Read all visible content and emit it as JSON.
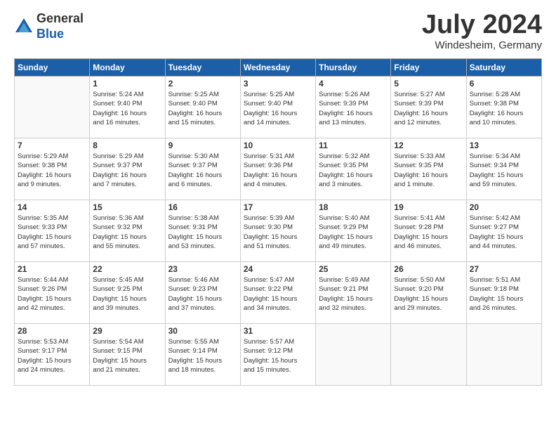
{
  "header": {
    "logo_general": "General",
    "logo_blue": "Blue",
    "month_title": "July 2024",
    "subtitle": "Windesheim, Germany"
  },
  "weekdays": [
    "Sunday",
    "Monday",
    "Tuesday",
    "Wednesday",
    "Thursday",
    "Friday",
    "Saturday"
  ],
  "weeks": [
    [
      {
        "day": "",
        "info": ""
      },
      {
        "day": "1",
        "info": "Sunrise: 5:24 AM\nSunset: 9:40 PM\nDaylight: 16 hours\nand 16 minutes."
      },
      {
        "day": "2",
        "info": "Sunrise: 5:25 AM\nSunset: 9:40 PM\nDaylight: 16 hours\nand 15 minutes."
      },
      {
        "day": "3",
        "info": "Sunrise: 5:25 AM\nSunset: 9:40 PM\nDaylight: 16 hours\nand 14 minutes."
      },
      {
        "day": "4",
        "info": "Sunrise: 5:26 AM\nSunset: 9:39 PM\nDaylight: 16 hours\nand 13 minutes."
      },
      {
        "day": "5",
        "info": "Sunrise: 5:27 AM\nSunset: 9:39 PM\nDaylight: 16 hours\nand 12 minutes."
      },
      {
        "day": "6",
        "info": "Sunrise: 5:28 AM\nSunset: 9:38 PM\nDaylight: 16 hours\nand 10 minutes."
      }
    ],
    [
      {
        "day": "7",
        "info": "Sunrise: 5:29 AM\nSunset: 9:38 PM\nDaylight: 16 hours\nand 9 minutes."
      },
      {
        "day": "8",
        "info": "Sunrise: 5:29 AM\nSunset: 9:37 PM\nDaylight: 16 hours\nand 7 minutes."
      },
      {
        "day": "9",
        "info": "Sunrise: 5:30 AM\nSunset: 9:37 PM\nDaylight: 16 hours\nand 6 minutes."
      },
      {
        "day": "10",
        "info": "Sunrise: 5:31 AM\nSunset: 9:36 PM\nDaylight: 16 hours\nand 4 minutes."
      },
      {
        "day": "11",
        "info": "Sunrise: 5:32 AM\nSunset: 9:35 PM\nDaylight: 16 hours\nand 3 minutes."
      },
      {
        "day": "12",
        "info": "Sunrise: 5:33 AM\nSunset: 9:35 PM\nDaylight: 16 hours\nand 1 minute."
      },
      {
        "day": "13",
        "info": "Sunrise: 5:34 AM\nSunset: 9:34 PM\nDaylight: 15 hours\nand 59 minutes."
      }
    ],
    [
      {
        "day": "14",
        "info": "Sunrise: 5:35 AM\nSunset: 9:33 PM\nDaylight: 15 hours\nand 57 minutes."
      },
      {
        "day": "15",
        "info": "Sunrise: 5:36 AM\nSunset: 9:32 PM\nDaylight: 15 hours\nand 55 minutes."
      },
      {
        "day": "16",
        "info": "Sunrise: 5:38 AM\nSunset: 9:31 PM\nDaylight: 15 hours\nand 53 minutes."
      },
      {
        "day": "17",
        "info": "Sunrise: 5:39 AM\nSunset: 9:30 PM\nDaylight: 15 hours\nand 51 minutes."
      },
      {
        "day": "18",
        "info": "Sunrise: 5:40 AM\nSunset: 9:29 PM\nDaylight: 15 hours\nand 49 minutes."
      },
      {
        "day": "19",
        "info": "Sunrise: 5:41 AM\nSunset: 9:28 PM\nDaylight: 15 hours\nand 46 minutes."
      },
      {
        "day": "20",
        "info": "Sunrise: 5:42 AM\nSunset: 9:27 PM\nDaylight: 15 hours\nand 44 minutes."
      }
    ],
    [
      {
        "day": "21",
        "info": "Sunrise: 5:44 AM\nSunset: 9:26 PM\nDaylight: 15 hours\nand 42 minutes."
      },
      {
        "day": "22",
        "info": "Sunrise: 5:45 AM\nSunset: 9:25 PM\nDaylight: 15 hours\nand 39 minutes."
      },
      {
        "day": "23",
        "info": "Sunrise: 5:46 AM\nSunset: 9:23 PM\nDaylight: 15 hours\nand 37 minutes."
      },
      {
        "day": "24",
        "info": "Sunrise: 5:47 AM\nSunset: 9:22 PM\nDaylight: 15 hours\nand 34 minutes."
      },
      {
        "day": "25",
        "info": "Sunrise: 5:49 AM\nSunset: 9:21 PM\nDaylight: 15 hours\nand 32 minutes."
      },
      {
        "day": "26",
        "info": "Sunrise: 5:50 AM\nSunset: 9:20 PM\nDaylight: 15 hours\nand 29 minutes."
      },
      {
        "day": "27",
        "info": "Sunrise: 5:51 AM\nSunset: 9:18 PM\nDaylight: 15 hours\nand 26 minutes."
      }
    ],
    [
      {
        "day": "28",
        "info": "Sunrise: 5:53 AM\nSunset: 9:17 PM\nDaylight: 15 hours\nand 24 minutes."
      },
      {
        "day": "29",
        "info": "Sunrise: 5:54 AM\nSunset: 9:15 PM\nDaylight: 15 hours\nand 21 minutes."
      },
      {
        "day": "30",
        "info": "Sunrise: 5:55 AM\nSunset: 9:14 PM\nDaylight: 15 hours\nand 18 minutes."
      },
      {
        "day": "31",
        "info": "Sunrise: 5:57 AM\nSunset: 9:12 PM\nDaylight: 15 hours\nand 15 minutes."
      },
      {
        "day": "",
        "info": ""
      },
      {
        "day": "",
        "info": ""
      },
      {
        "day": "",
        "info": ""
      }
    ]
  ]
}
